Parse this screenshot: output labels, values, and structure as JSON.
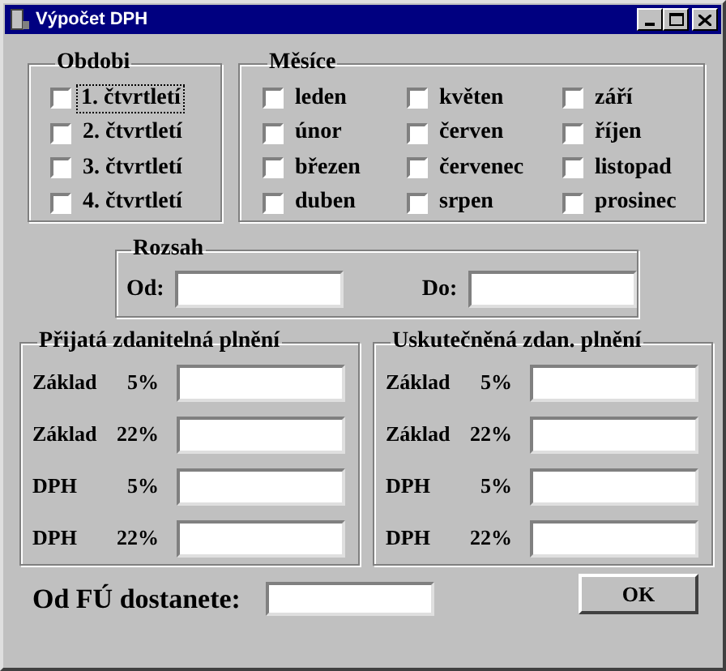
{
  "window": {
    "title": "Výpočet DPH"
  },
  "obdobi": {
    "title": "Obdobi",
    "items": [
      {
        "label": "1. čtvrtletí",
        "checked": false,
        "focused": true
      },
      {
        "label": "2. čtvrtletí",
        "checked": false,
        "focused": false
      },
      {
        "label": "3. čtvrtletí",
        "checked": false,
        "focused": false
      },
      {
        "label": "4. čtvrtletí",
        "checked": false,
        "focused": false
      }
    ]
  },
  "mesice": {
    "title": "Měsíce",
    "items": [
      {
        "label": "leden",
        "checked": false
      },
      {
        "label": "květen",
        "checked": false
      },
      {
        "label": "září",
        "checked": false
      },
      {
        "label": "únor",
        "checked": false
      },
      {
        "label": "červen",
        "checked": false
      },
      {
        "label": "říjen",
        "checked": false
      },
      {
        "label": "březen",
        "checked": false
      },
      {
        "label": "červenec",
        "checked": false
      },
      {
        "label": "listopad",
        "checked": false
      },
      {
        "label": "duben",
        "checked": false
      },
      {
        "label": "srpen",
        "checked": false
      },
      {
        "label": "prosinec",
        "checked": false
      }
    ]
  },
  "rozsah": {
    "title": "Rozsah",
    "fields": [
      {
        "label": "Od:"
      },
      {
        "label": "Do:"
      }
    ]
  },
  "groups": [
    {
      "title": "Přijatá zdanitelná plnění",
      "fields": [
        {
          "label": "Základ",
          "rate": "5%"
        },
        {
          "label": "Základ",
          "rate": "22%"
        },
        {
          "label": "DPH",
          "rate": "5%"
        },
        {
          "label": "DPH",
          "rate": "22%"
        }
      ]
    },
    {
      "title": "Uskutečněná zdan. plnění",
      "fields": [
        {
          "label": "Základ",
          "rate": "5%"
        },
        {
          "label": "Základ",
          "rate": "22%"
        },
        {
          "label": "DPH",
          "rate": "5%"
        },
        {
          "label": "DPH",
          "rate": "22%"
        }
      ]
    }
  ],
  "result": {
    "label": "Od FÚ dostanete:"
  },
  "buttons": [
    "OK"
  ]
}
